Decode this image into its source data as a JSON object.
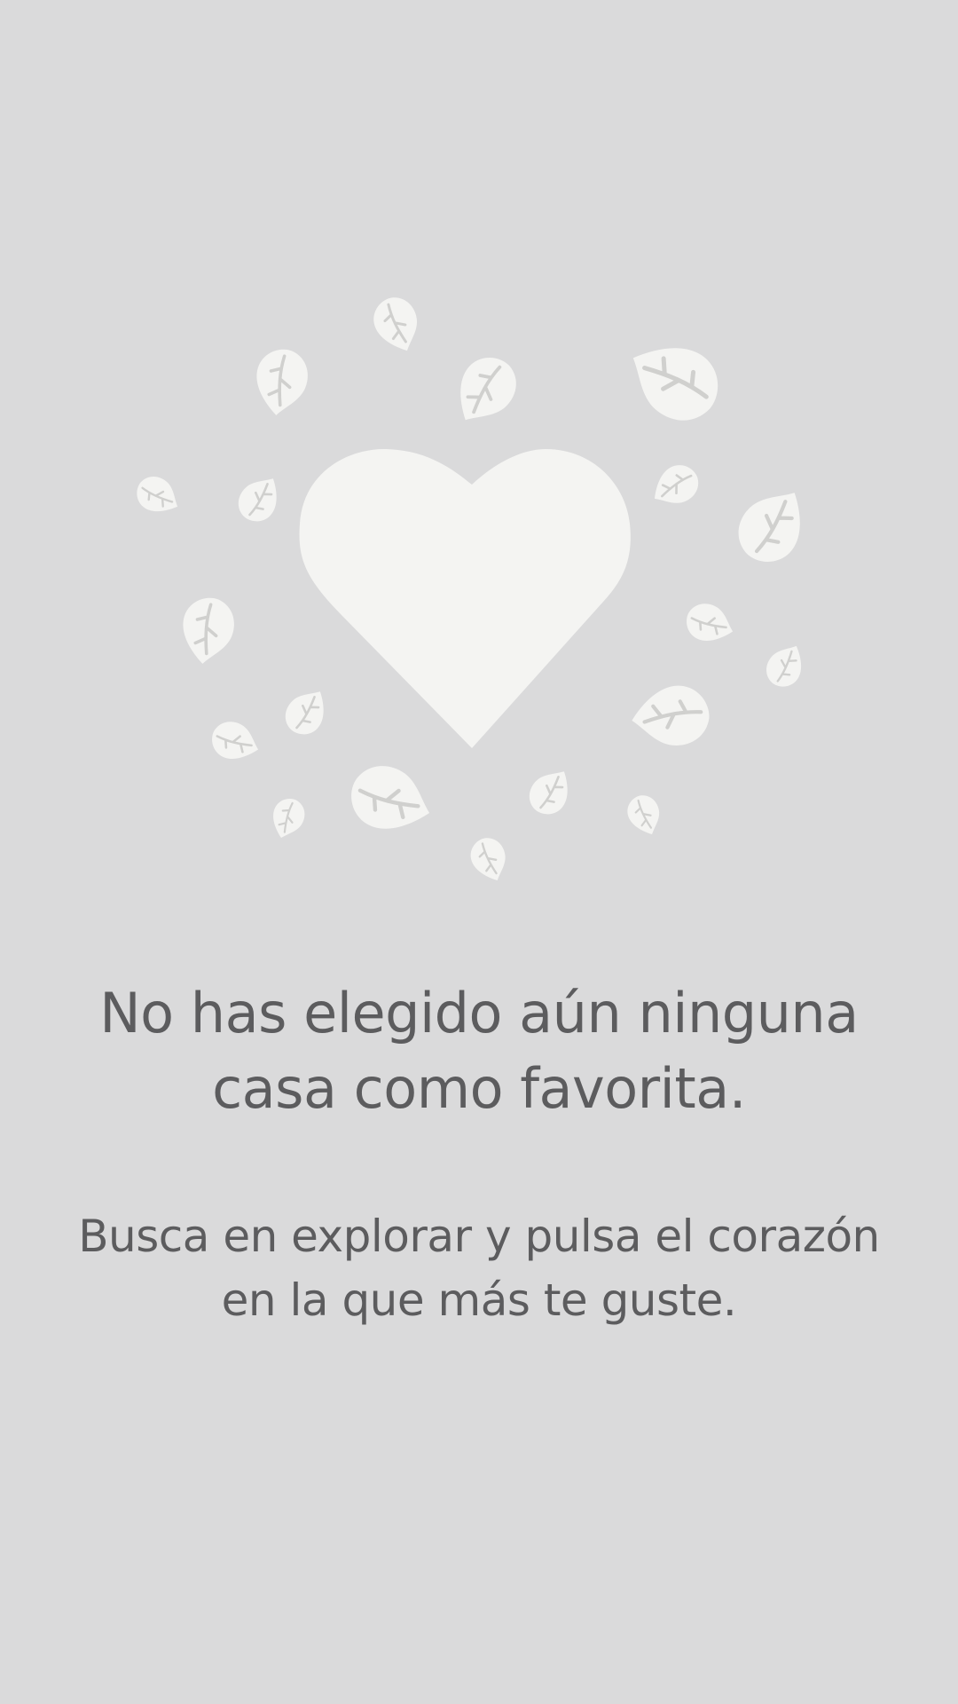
{
  "empty_state": {
    "title_lines": [
      "No has elegido aún ninguna",
      "casa como favorita."
    ],
    "body_lines": [
      "Busca en explorar y pulsa el corazón",
      "en la que más te guste."
    ],
    "illustration": {
      "icon": "heart-with-leaves-icon",
      "heart_color": "#F4F4F2",
      "leaf_color": "#F4F4F2"
    }
  },
  "colors": {
    "background": "#DADADB",
    "text": "#5C5C5E"
  }
}
